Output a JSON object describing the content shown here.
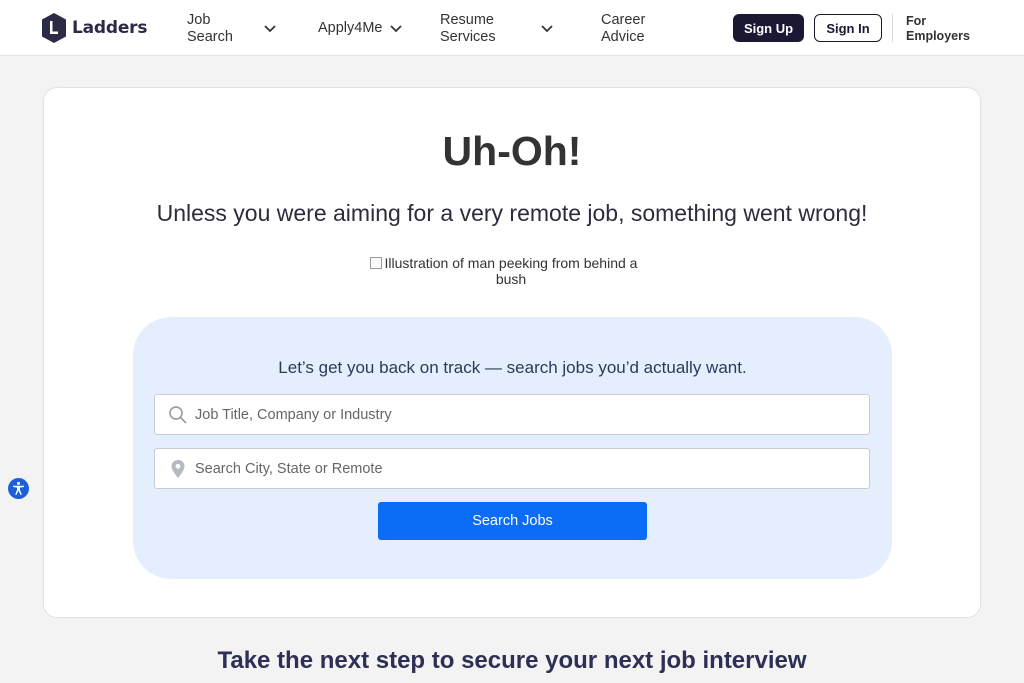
{
  "header": {
    "logo_text": "Ladders",
    "nav": [
      {
        "line1": "Job",
        "line2": "Search"
      },
      {
        "line1": "Apply4Me",
        "line2": ""
      },
      {
        "line1": "Resume",
        "line2": "Services"
      },
      {
        "line1": "Career",
        "line2": "Advice"
      }
    ],
    "signup_label": "Sign Up",
    "signin_label": "Sign In",
    "employers_line1": "For",
    "employers_line2": "Employers"
  },
  "error": {
    "headline": "Uh-Oh!",
    "subline": "Unless you were aiming for a very remote job, something went wrong!",
    "image_alt": "Illustration of man peeking from behind a bush"
  },
  "search": {
    "title": "Let’s get you back on track — search jobs you’d actually want.",
    "keyword_placeholder": "Job Title, Company or Industry",
    "location_placeholder": "Search City, State or Remote",
    "button_label": "Search Jobs"
  },
  "footer": {
    "title": "Take the next step to secure your next job interview"
  },
  "colors": {
    "brand_dark": "#1b1833",
    "accent_blue": "#0a6cf7",
    "panel_bg": "#e4eefc"
  },
  "icons": {
    "logo": "ladders-logo-icon",
    "search": "search-icon",
    "location": "location-pin-icon",
    "chevron": "chevron-down-icon",
    "accessibility": "accessibility-icon"
  }
}
